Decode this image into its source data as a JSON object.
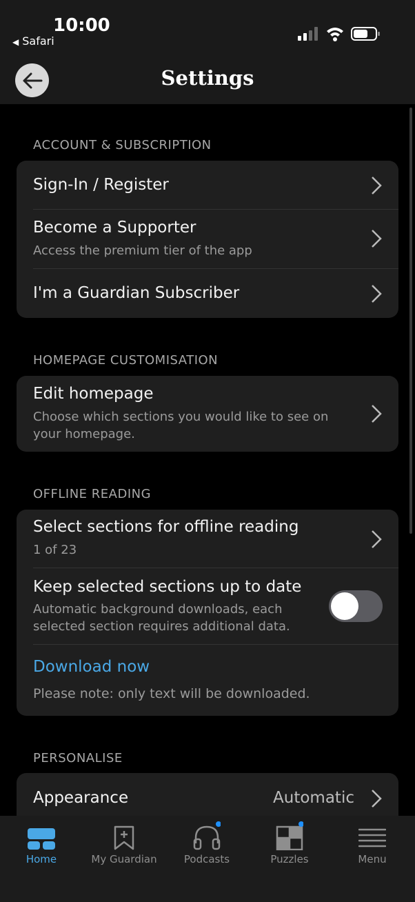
{
  "status": {
    "time": "10:00",
    "back_app": "Safari"
  },
  "header": {
    "title": "Settings"
  },
  "sections": {
    "account": {
      "header": "ACCOUNT & SUBSCRIPTION",
      "sign_in": "Sign-In / Register",
      "supporter_title": "Become a Supporter",
      "supporter_sub": "Access the premium tier of the app",
      "subscriber": "I'm a Guardian Subscriber"
    },
    "homepage": {
      "header": "HOMEPAGE CUSTOMISATION",
      "edit_title": "Edit homepage",
      "edit_sub": "Choose which sections you would like to see on your homepage."
    },
    "offline": {
      "header": "OFFLINE READING",
      "select_title": "Select sections for offline reading",
      "select_sub": "1 of 23",
      "keep_title": "Keep selected sections up to date",
      "keep_sub": "Automatic background downloads, each selected section requires additional data.",
      "keep_enabled": false,
      "download": "Download now",
      "note": "Please note: only text will be downloaded."
    },
    "personalise": {
      "header": "PERSONALISE",
      "appearance_title": "Appearance",
      "appearance_value": "Automatic"
    }
  },
  "tabs": [
    {
      "label": "Home",
      "icon": "home-icon",
      "active": true
    },
    {
      "label": "My Guardian",
      "icon": "bookmark-icon",
      "active": false
    },
    {
      "label": "Podcasts",
      "icon": "headphones-icon",
      "active": false,
      "badge": true
    },
    {
      "label": "Puzzles",
      "icon": "crossword-icon",
      "active": false,
      "badge": true
    },
    {
      "label": "Menu",
      "icon": "menu-icon",
      "active": false
    }
  ],
  "colors": {
    "accent": "#4aa8e6",
    "badge": "#1e90ff",
    "toggle_off": "#5b5b60"
  }
}
